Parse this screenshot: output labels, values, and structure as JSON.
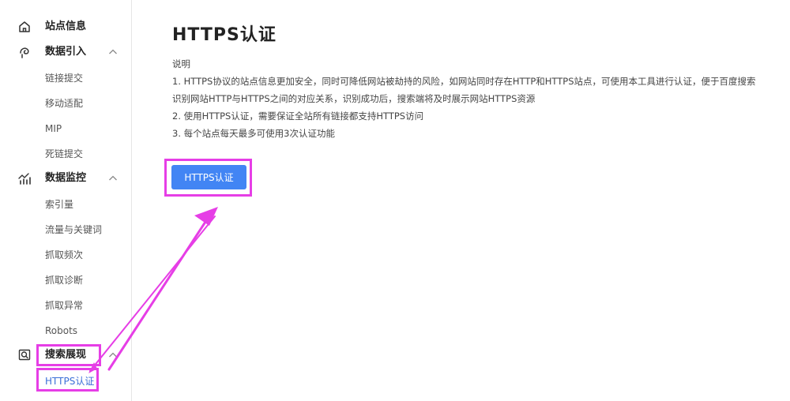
{
  "sidebar": {
    "groups": [
      {
        "label": "站点信息",
        "icon": "home-icon"
      },
      {
        "label": "数据引入",
        "icon": "data-import-icon",
        "items": [
          "链接提交",
          "移动适配",
          "MIP",
          "死链提交"
        ]
      },
      {
        "label": "数据监控",
        "icon": "chart-monitor-icon",
        "items": [
          "索引量",
          "流量与关键词",
          "抓取频次",
          "抓取诊断",
          "抓取异常",
          "Robots"
        ]
      },
      {
        "label": "搜索展现",
        "icon": "search-display-icon",
        "items": [
          "HTTPS认证"
        ]
      }
    ],
    "active_item": "HTTPS认证"
  },
  "main": {
    "title": "HTTPS认证",
    "desc_heading": "说明",
    "desc_lines": [
      "1. HTTPS协议的站点信息更加安全，同时可降低网站被劫持的风险，如网站同时存在HTTP和HTTPS站点，可使用本工具进行认证，便于百度搜索",
      "识别网站HTTP与HTTPS之间的对应关系，识别成功后，搜索端将及时展示网站HTTPS资源",
      "2. 使用HTTPS认证，需要保证全站所有链接都支持HTTPS访问",
      "3. 每个站点每天最多可使用3次认证功能"
    ],
    "button_label": "HTTPS认证"
  },
  "colors": {
    "accent": "#4285f4",
    "active_link": "#3b6fd8",
    "annotation": "#e63ee6"
  }
}
